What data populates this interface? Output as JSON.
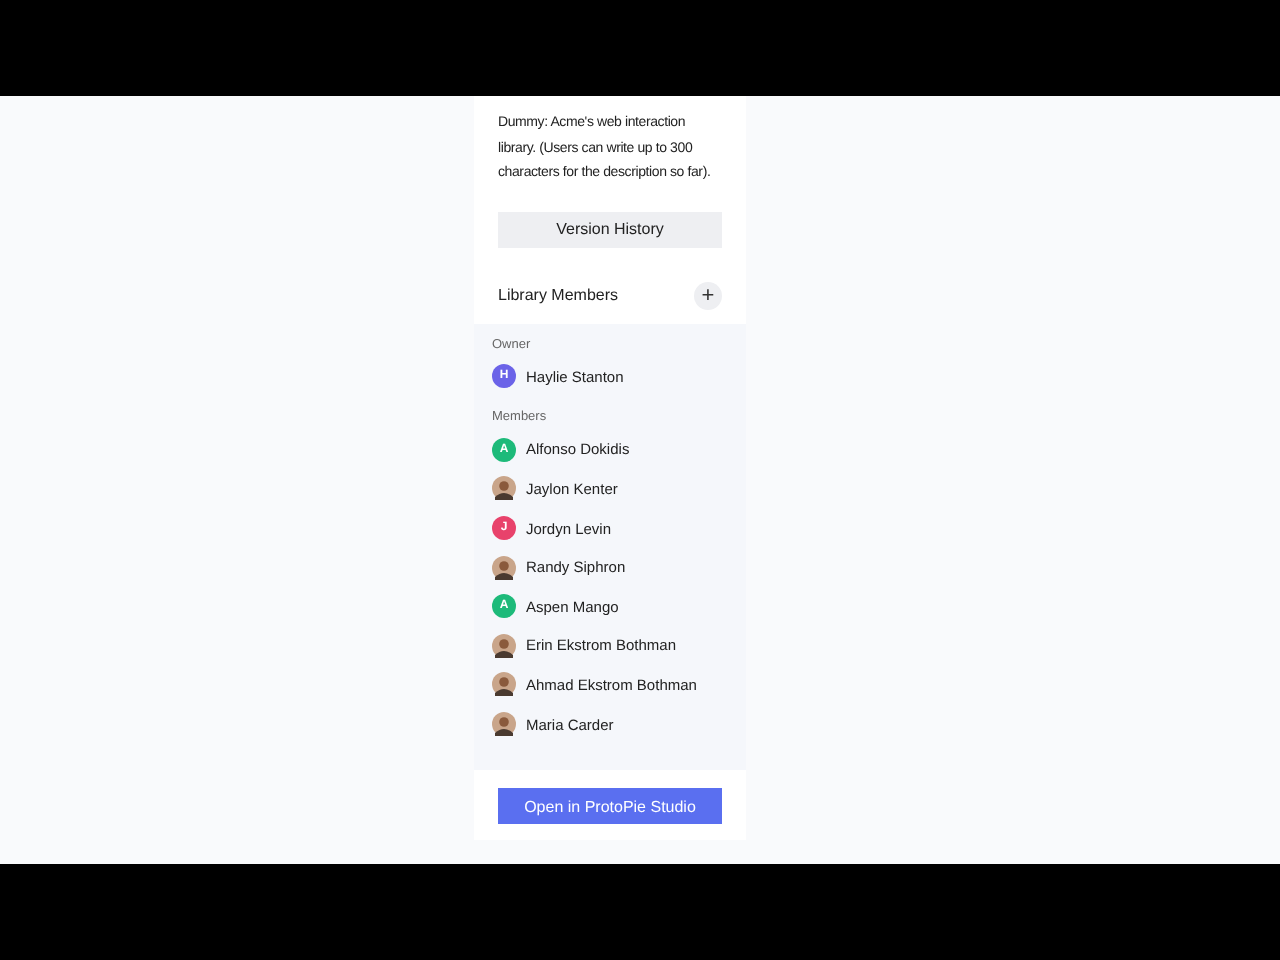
{
  "description": "Dummy: Acme's web interaction library. (Users can write up to 300 characters for the description so far).",
  "version_button": "Version History",
  "members_section": {
    "title": "Library Members",
    "add_button": "+"
  },
  "groups": [
    {
      "label": "Owner",
      "people": [
        {
          "name": "Haylie Stanton",
          "avatar": {
            "kind": "initial",
            "letter": "H",
            "color": "#6b63e8"
          }
        }
      ]
    },
    {
      "label": "Members",
      "people": [
        {
          "name": "Alfonso Dokidis",
          "avatar": {
            "kind": "initial",
            "letter": "A",
            "color": "#1dba7a"
          }
        },
        {
          "name": "Jaylon Kenter",
          "avatar": {
            "kind": "photo"
          }
        },
        {
          "name": "Jordyn Levin",
          "avatar": {
            "kind": "initial",
            "letter": "J",
            "color": "#e8426b"
          }
        },
        {
          "name": "Randy Siphron",
          "avatar": {
            "kind": "photo"
          }
        },
        {
          "name": "Aspen Mango",
          "avatar": {
            "kind": "initial",
            "letter": "A",
            "color": "#1dba7a"
          }
        },
        {
          "name": "Erin Ekstrom Bothman",
          "avatar": {
            "kind": "photo"
          }
        },
        {
          "name": "Ahmad Ekstrom Bothman",
          "avatar": {
            "kind": "photo"
          }
        },
        {
          "name": "Maria Carder",
          "avatar": {
            "kind": "photo"
          }
        }
      ]
    }
  ],
  "open_button": "Open in ProtoPie Studio"
}
